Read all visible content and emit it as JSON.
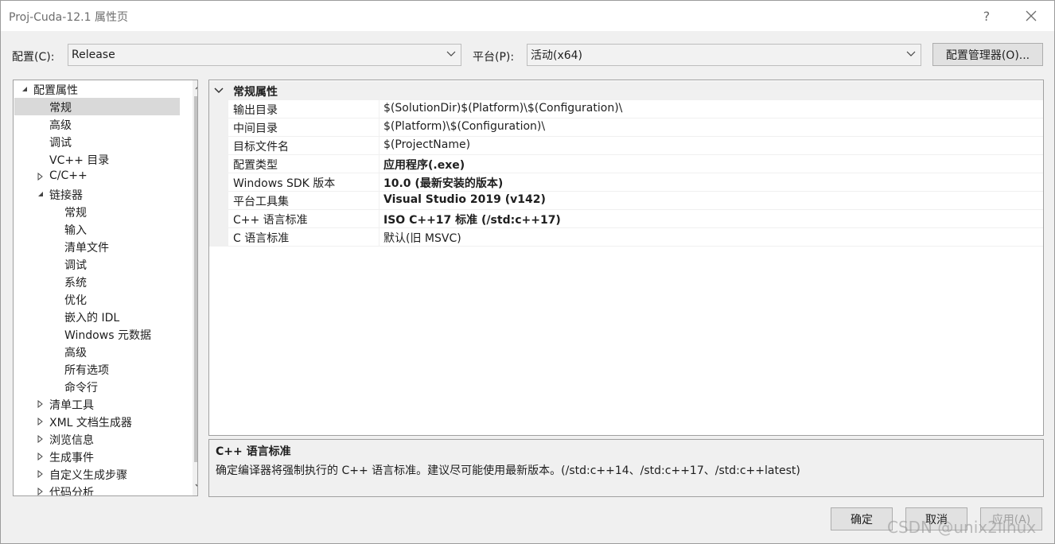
{
  "window": {
    "title": "Proj-Cuda-12.1 属性页",
    "help_label": "?"
  },
  "toolbar": {
    "config_label": "配置(C):",
    "config_value": "Release",
    "platform_label": "平台(P):",
    "platform_value": "活动(x64)",
    "config_manager_label": "配置管理器(O)..."
  },
  "tree": {
    "items": [
      {
        "label": "配置属性",
        "level": 0,
        "expander": "expanded"
      },
      {
        "label": "常规",
        "level": 1,
        "expander": "none",
        "selected": true
      },
      {
        "label": "高级",
        "level": 1,
        "expander": "none"
      },
      {
        "label": "调试",
        "level": 1,
        "expander": "none"
      },
      {
        "label": "VC++ 目录",
        "level": 1,
        "expander": "none"
      },
      {
        "label": "C/C++",
        "level": 1,
        "expander": "collapsed"
      },
      {
        "label": "链接器",
        "level": 1,
        "expander": "expanded"
      },
      {
        "label": "常规",
        "level": 2,
        "expander": "none"
      },
      {
        "label": "输入",
        "level": 2,
        "expander": "none"
      },
      {
        "label": "清单文件",
        "level": 2,
        "expander": "none"
      },
      {
        "label": "调试",
        "level": 2,
        "expander": "none"
      },
      {
        "label": "系统",
        "level": 2,
        "expander": "none"
      },
      {
        "label": "优化",
        "level": 2,
        "expander": "none"
      },
      {
        "label": "嵌入的 IDL",
        "level": 2,
        "expander": "none"
      },
      {
        "label": "Windows 元数据",
        "level": 2,
        "expander": "none"
      },
      {
        "label": "高级",
        "level": 2,
        "expander": "none"
      },
      {
        "label": "所有选项",
        "level": 2,
        "expander": "none"
      },
      {
        "label": "命令行",
        "level": 2,
        "expander": "none"
      },
      {
        "label": "清单工具",
        "level": 1,
        "expander": "collapsed"
      },
      {
        "label": "XML 文档生成器",
        "level": 1,
        "expander": "collapsed"
      },
      {
        "label": "浏览信息",
        "level": 1,
        "expander": "collapsed"
      },
      {
        "label": "生成事件",
        "level": 1,
        "expander": "collapsed"
      },
      {
        "label": "自定义生成步骤",
        "level": 1,
        "expander": "collapsed"
      },
      {
        "label": "代码分析",
        "level": 1,
        "expander": "collapsed"
      }
    ]
  },
  "grid": {
    "category": "常规属性",
    "properties": [
      {
        "name": "输出目录",
        "value": "$(SolutionDir)$(Platform)\\$(Configuration)\\",
        "bold": false
      },
      {
        "name": "中间目录",
        "value": "$(Platform)\\$(Configuration)\\",
        "bold": false
      },
      {
        "name": "目标文件名",
        "value": "$(ProjectName)",
        "bold": false
      },
      {
        "name": "配置类型",
        "value": "应用程序(.exe)",
        "bold": true
      },
      {
        "name": "Windows SDK 版本",
        "value": "10.0 (最新安装的版本)",
        "bold": true
      },
      {
        "name": "平台工具集",
        "value": "Visual Studio 2019 (v142)",
        "bold": true
      },
      {
        "name": "C++ 语言标准",
        "value": "ISO C++17 标准 (/std:c++17)",
        "bold": true
      },
      {
        "name": "C 语言标准",
        "value": "默认(旧 MSVC)",
        "bold": false
      }
    ]
  },
  "description": {
    "title": "C++ 语言标准",
    "text": "确定编译器将强制执行的 C++ 语言标准。建议尽可能使用最新版本。(/std:c++14、/std:c++17、/std:c++latest)"
  },
  "buttons": {
    "ok": "确定",
    "cancel": "取消",
    "apply": "应用(A)"
  },
  "watermark": "CSDN @unix2linux"
}
